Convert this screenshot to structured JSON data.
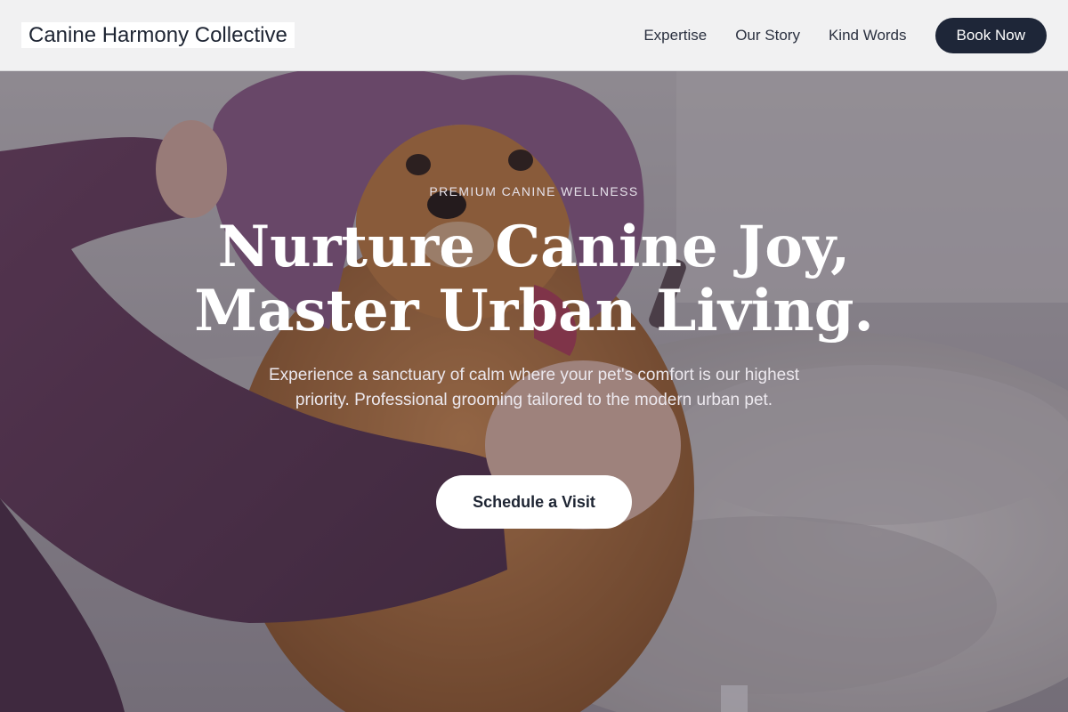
{
  "brand": {
    "name": "Canine Harmony Collective"
  },
  "nav": {
    "links": [
      "Expertise",
      "Our Story",
      "Kind Words"
    ],
    "cta_label": "Book Now"
  },
  "hero": {
    "eyebrow": "PREMIUM CANINE WELLNESS",
    "headline_line1": "Nurture Canine Joy,",
    "headline_line2": "Master Urban Living.",
    "subtext": "Experience a sanctuary of calm where your pet's comfort is our highest priority. Professional grooming tailored to the modern urban pet.",
    "cta_label": "Schedule a Visit",
    "image_subject": "small orange dog wrapped in a purple towel being groomed"
  },
  "colors": {
    "nav_background": "#f1f1f2",
    "brand_text": "#1e2533",
    "nav_cta_background": "#1e2638",
    "hero_overlay": "#302a38",
    "towel_purple": "#8b5a86",
    "dog_orange": "#b86d33"
  }
}
